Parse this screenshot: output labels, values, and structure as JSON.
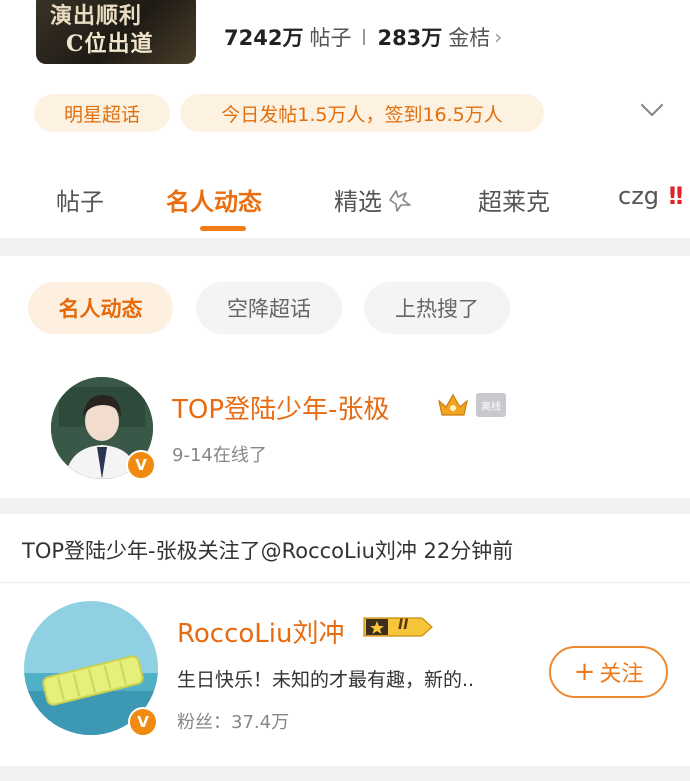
{
  "header": {
    "cover_line1": "演出顺利",
    "cover_line2": "C位出道",
    "posts_count": "7242万",
    "posts_label": "帖子",
    "coins_count": "283万",
    "coins_label": "金桔"
  },
  "info_chips": {
    "category": "明星超话",
    "daily_stats": "今日发帖1.5万人，签到16.5万人"
  },
  "tabs": [
    {
      "label": "帖子"
    },
    {
      "label": "名人动态"
    },
    {
      "label": "精选"
    },
    {
      "label": "超莱克"
    },
    {
      "label": "czg"
    }
  ],
  "filters": [
    {
      "label": "名人动态"
    },
    {
      "label": "空降超话"
    },
    {
      "label": "上热搜了"
    }
  ],
  "celebrity": {
    "name": "TOP登陆少年-张极",
    "status_tag": "离线",
    "last_online": "9-14在线了"
  },
  "activity": {
    "text": "TOP登陆少年-张极关注了@RoccoLiu刘冲 22分钟前"
  },
  "followed_user": {
    "name": "RoccoLiu刘冲",
    "level": "II",
    "bio": "生日快乐！未知的才最有趣，新的..",
    "fans": "粉丝：37.4万",
    "follow_label": "关注"
  },
  "colors": {
    "accent": "#ea6e10",
    "chip_bg": "#fdf1e2",
    "gap": "#f2f2f2",
    "alert": "#e0242a"
  }
}
